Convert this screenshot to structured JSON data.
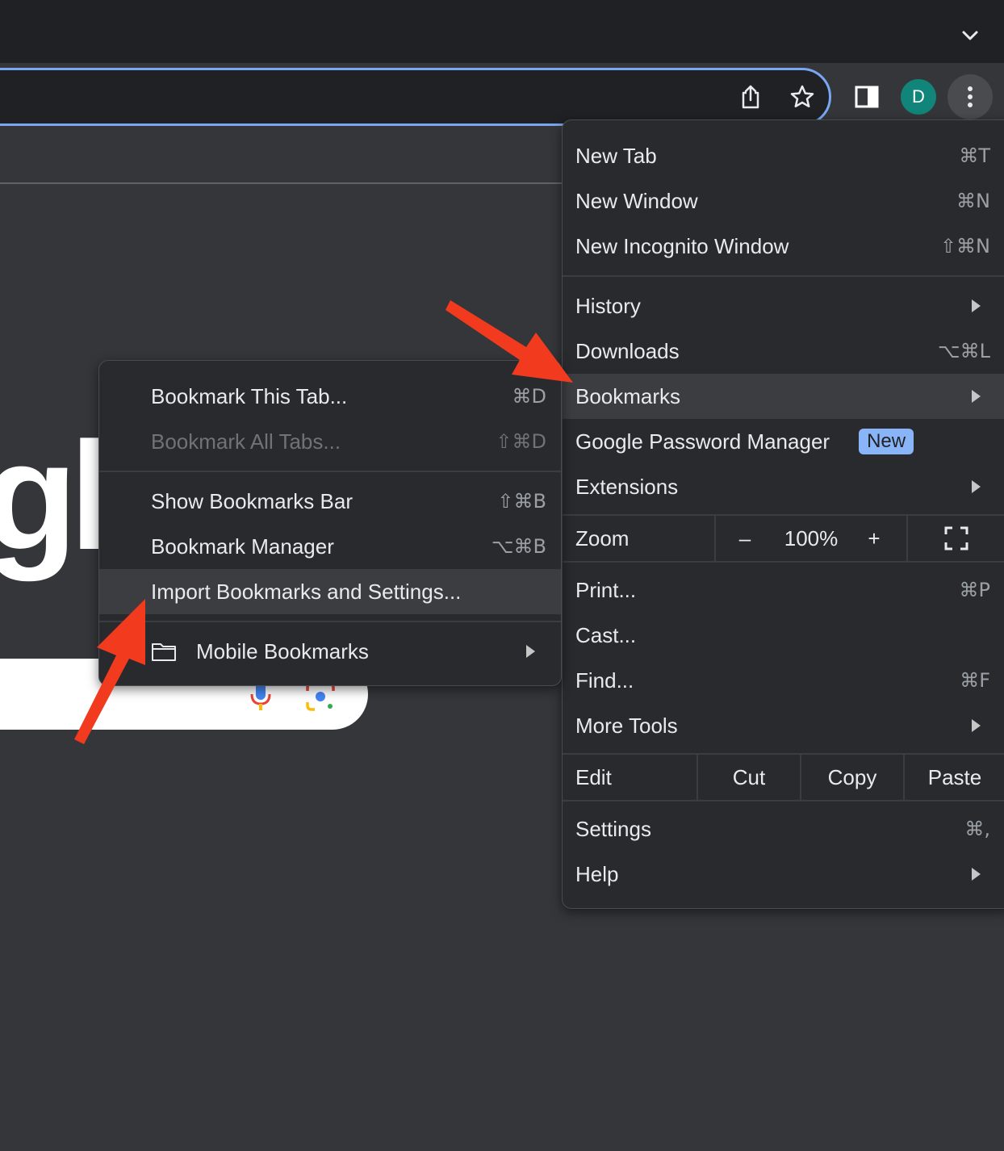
{
  "browser": {
    "avatar_letter": "D",
    "accent_color": "#7aa7f2"
  },
  "main_menu": {
    "new_tab": {
      "label": "New Tab",
      "shortcut": "⌘T"
    },
    "new_window": {
      "label": "New Window",
      "shortcut": "⌘N"
    },
    "new_incognito": {
      "label": "New Incognito Window",
      "shortcut": "⇧⌘N"
    },
    "history": {
      "label": "History"
    },
    "downloads": {
      "label": "Downloads",
      "shortcut": "⌥⌘L"
    },
    "bookmarks": {
      "label": "Bookmarks"
    },
    "password_manager": {
      "label": "Google Password Manager",
      "badge": "New"
    },
    "extensions": {
      "label": "Extensions"
    },
    "zoom": {
      "label": "Zoom",
      "minus": "–",
      "value": "100%",
      "plus": "+"
    },
    "print": {
      "label": "Print...",
      "shortcut": "⌘P"
    },
    "cast": {
      "label": "Cast..."
    },
    "find": {
      "label": "Find...",
      "shortcut": "⌘F"
    },
    "more_tools": {
      "label": "More Tools"
    },
    "edit": {
      "label": "Edit",
      "cut": "Cut",
      "copy": "Copy",
      "paste": "Paste"
    },
    "settings": {
      "label": "Settings",
      "shortcut": "⌘,"
    },
    "help": {
      "label": "Help"
    }
  },
  "bookmarks_submenu": {
    "bookmark_tab": {
      "label": "Bookmark This Tab...",
      "shortcut": "⌘D"
    },
    "bookmark_all": {
      "label": "Bookmark All Tabs...",
      "shortcut": "⇧⌘D"
    },
    "show_bar": {
      "label": "Show Bookmarks Bar",
      "shortcut": "⇧⌘B"
    },
    "manager": {
      "label": "Bookmark Manager",
      "shortcut": "⌥⌘B"
    },
    "import": {
      "label": "Import Bookmarks and Settings..."
    },
    "mobile": {
      "label": "Mobile Bookmarks"
    }
  },
  "page": {
    "logo_fragment": "gle"
  },
  "annotation_color": "#f23a1f"
}
